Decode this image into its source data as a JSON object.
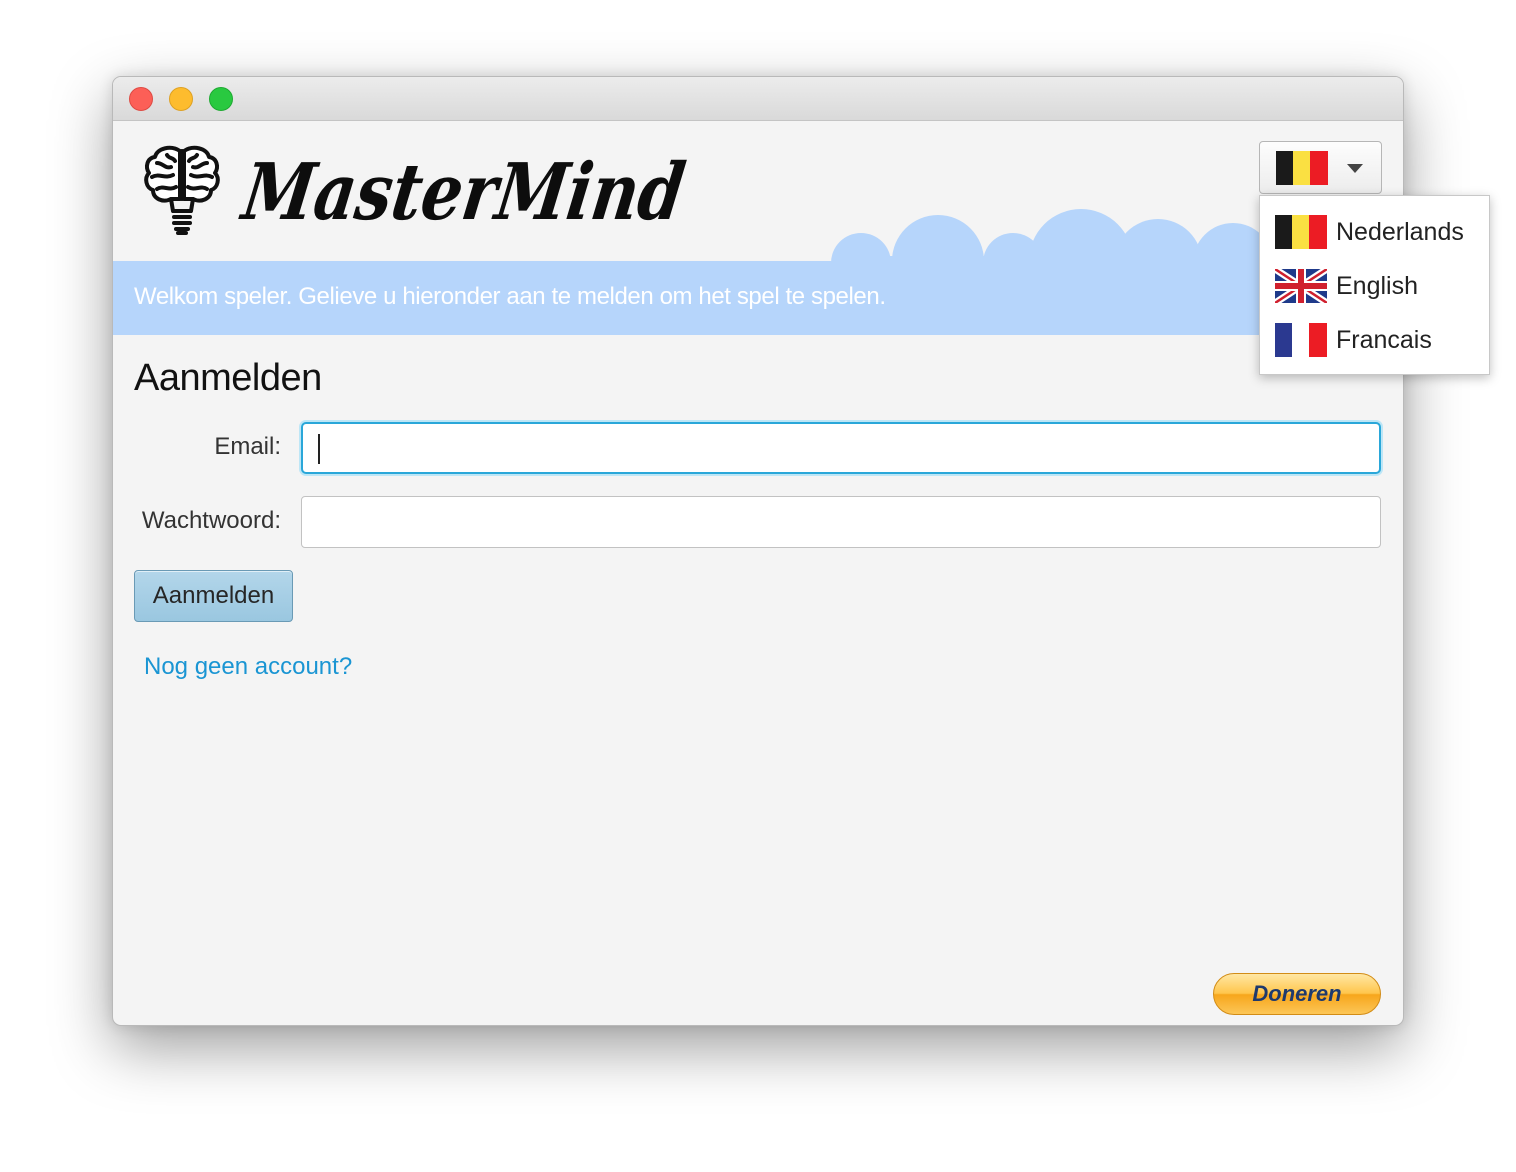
{
  "app": {
    "logo_text": "MasterMind"
  },
  "banner": {
    "text": "Welkom speler. Gelieve u hieronder aan te melden om het spel te spelen."
  },
  "login": {
    "title": "Aanmelden",
    "email_label": "Email:",
    "email_value": "",
    "password_label": "Wachtwoord:",
    "password_value": "",
    "submit_label": "Aanmelden",
    "signup_link": "Nog geen account?"
  },
  "donate": {
    "label": "Doneren"
  },
  "language": {
    "selected_icon": "belgium-flag-icon",
    "options": [
      {
        "label": "Nederlands",
        "icon": "belgium-flag-icon"
      },
      {
        "label": "English",
        "icon": "uk-flag-icon"
      },
      {
        "label": "Francais",
        "icon": "france-flag-icon"
      }
    ]
  },
  "colors": {
    "banner_bg": "#b6d5fb",
    "link": "#1a95d3",
    "focus_ring": "#2aa7d9",
    "button_bg": "#a6cde3",
    "donate_bg": "#ffc64d"
  }
}
